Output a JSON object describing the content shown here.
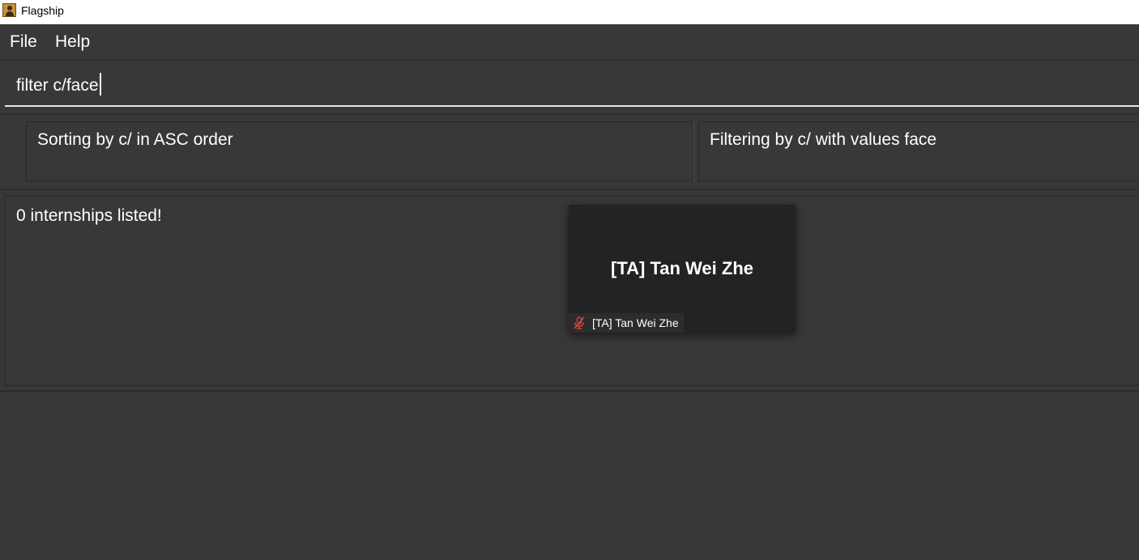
{
  "window": {
    "title": "Flagship",
    "icon": "flagship-app-icon"
  },
  "menu": {
    "items": [
      "File",
      "Help"
    ]
  },
  "command": {
    "value": "filter c/face"
  },
  "status": {
    "sort": "Sorting by c/ in ASC order",
    "filter": "Filtering by c/ with values face"
  },
  "result": {
    "message": "0 internships listed!"
  },
  "video_tile": {
    "name": "[TA] Tan Wei Zhe",
    "label": "[TA] Tan Wei Zhe",
    "icon": "mic-muted-icon",
    "icon_color": "#e0413a"
  }
}
